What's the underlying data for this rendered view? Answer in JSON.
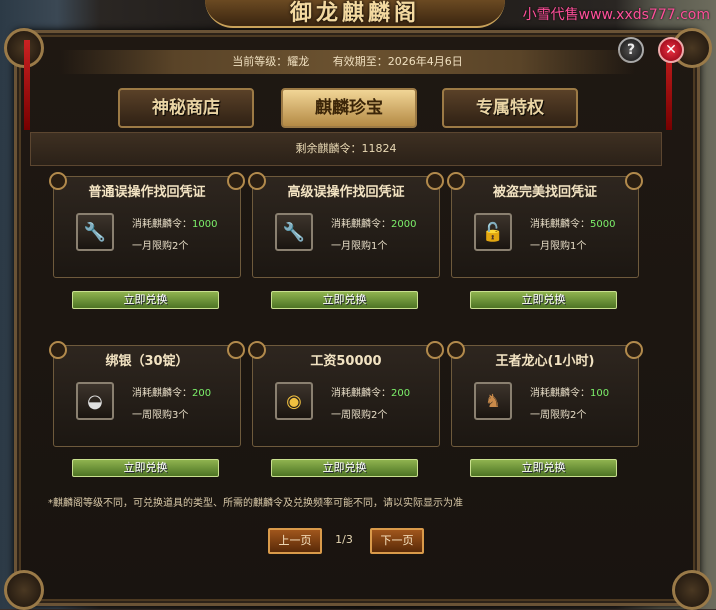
{
  "window_title": "御龙麒麟阁",
  "watermark": "小雪代售www.xxds777.com",
  "info": {
    "level_label": "当前等级：耀龙",
    "expiry_label": "有效期至：2026年4月6日"
  },
  "tabs": [
    {
      "label": "神秘商店",
      "active": false
    },
    {
      "label": "麒麟珍宝",
      "active": true
    },
    {
      "label": "专属特权",
      "active": false
    }
  ],
  "remaining": "剩余麒麟令：11824",
  "cost_prefix": "消耗麒麟令：",
  "items": [
    {
      "name": "普通误操作找回凭证",
      "cost": "1000",
      "limit": "一月限购2个",
      "icon": "wrench-icon"
    },
    {
      "name": "高级误操作找回凭证",
      "cost": "2000",
      "limit": "一月限购1个",
      "icon": "wrench-icon"
    },
    {
      "name": "被盗完美找回凭证",
      "cost": "5000",
      "limit": "一月限购1个",
      "icon": "lock-icon"
    },
    {
      "name": "绑银（30锭）",
      "cost": "200",
      "limit": "一周限购3个",
      "icon": "silver-ingot-icon"
    },
    {
      "name": "工资50000",
      "cost": "200",
      "limit": "一周限购2个",
      "icon": "gold-coins-icon"
    },
    {
      "name": "王者龙心(1小时)",
      "cost": "100",
      "limit": "一周限购2个",
      "icon": "dragon-icon"
    }
  ],
  "exchange_label": "立即兑换",
  "note": "*麒麟阁等级不同，可兑换道具的类型、所需的麒麟令及兑换频率可能不同，请以实际显示为准",
  "pagination": {
    "prev_label": "上一页",
    "page": "1/3",
    "next_label": "下一页"
  },
  "colors": {
    "accent_gold": "#e9d4a4",
    "cost_green": "#7cf06a",
    "exchange_green": "#6e9a36"
  }
}
